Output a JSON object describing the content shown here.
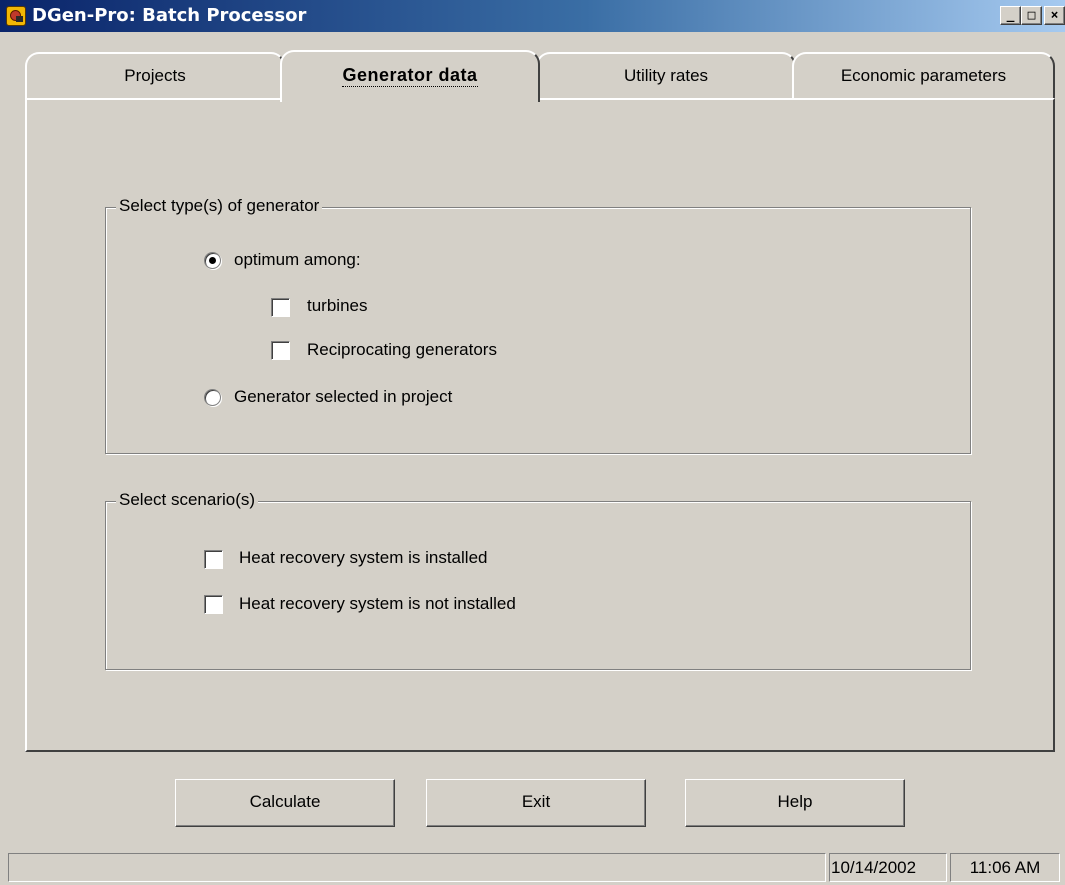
{
  "window": {
    "title": "DGen-Pro: Batch Processor",
    "controls": {
      "minimize": "_",
      "maximize": "□",
      "close": "×"
    }
  },
  "tabs": [
    {
      "label": "Projects",
      "active": false
    },
    {
      "label": "Generator data",
      "active": true
    },
    {
      "label": "Utility rates",
      "active": false
    },
    {
      "label": "Economic parameters",
      "active": false
    }
  ],
  "generator_group": {
    "title": "Select type(s) of generator",
    "options": {
      "optimum": {
        "label": "optimum among:",
        "selected": true
      },
      "turbines": {
        "label": "turbines",
        "checked": false
      },
      "reciprocating": {
        "label": "Reciprocating generators",
        "checked": false
      },
      "project": {
        "label": "Generator selected in project",
        "selected": false
      }
    }
  },
  "scenario_group": {
    "title": "Select scenario(s)",
    "options": {
      "installed": {
        "label": "Heat recovery system is installed",
        "checked": false
      },
      "not_installed": {
        "label": "Heat recovery system is not installed",
        "checked": false
      }
    }
  },
  "buttons": {
    "calculate": "Calculate",
    "exit": "Exit",
    "help": "Help"
  },
  "status_bar": {
    "message": "",
    "date": "10/14/2002",
    "time": "11:06 AM"
  },
  "icons": {
    "app": "dgen-app-icon",
    "radio_checked": "radio-checked",
    "radio_unchecked": "radio-unchecked",
    "checkbox_unchecked": "checkbox-unchecked"
  },
  "colors": {
    "titlebar_start": "#0a246a",
    "titlebar_end": "#a6caf0",
    "face": "#d4d0c8",
    "shadow": "#808080",
    "highlight": "#ffffff"
  }
}
